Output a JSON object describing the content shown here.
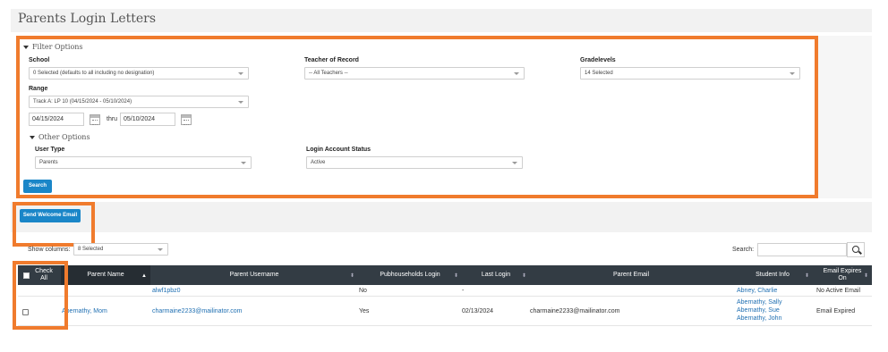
{
  "page": {
    "title": "Parents Login Letters"
  },
  "filter": {
    "section_label": "Filter Options",
    "school": {
      "label": "School",
      "value": "0 Selected (defaults to all including no designation)"
    },
    "teacher": {
      "label": "Teacher of Record",
      "value": "-- All Teachers --"
    },
    "gradelevels": {
      "label": "Gradelevels",
      "value": "14 Selected"
    },
    "range": {
      "label": "Range",
      "value": "Track A: LP 10 (04/15/2024 - 05/10/2024)",
      "start": "04/15/2024",
      "thru": "thru",
      "end": "05/10/2024"
    },
    "other_label": "Other Options",
    "user_type": {
      "label": "User Type",
      "value": "Parents"
    },
    "login_status": {
      "label": "Login Account Status",
      "value": "Active"
    },
    "search_button": "Search"
  },
  "welcome_button": "Send Welcome Email",
  "table_controls": {
    "show_columns_label": "Show columns:",
    "show_columns_value": "8 Selected",
    "search_label": "Search:"
  },
  "table": {
    "headers": {
      "check_all": "Check All",
      "parent_name": "Parent Name",
      "parent_username": "Parent Username",
      "pubhouseholds_login": "Pubhouseholds Login",
      "last_login": "Last Login",
      "parent_email": "Parent Email",
      "student_info": "Student Info",
      "email_expires": "Email Expires On"
    },
    "rows": [
      {
        "parent_name": "",
        "username": "alwf1pbz0",
        "pubhouseholds_login": "No",
        "last_login": "-",
        "email": "",
        "students": [
          "Abney, Charlie"
        ],
        "email_expires": "No Active Email"
      },
      {
        "parent_name": "Abernathy, Mom",
        "username": "charmaine2233@mailinator.com",
        "pubhouseholds_login": "Yes",
        "last_login": "02/13/2024",
        "email": "charmaine2233@mailinator.com",
        "students": [
          "Abernathy, Sally",
          "Abernathy, Sue",
          "Abernathy, John"
        ],
        "email_expires": "Email Expired"
      }
    ]
  },
  "colors": {
    "highlight": "#f07b2d",
    "header_bg": "#333c44",
    "button_blue": "#1a86c8",
    "link": "#1f6fb2"
  }
}
